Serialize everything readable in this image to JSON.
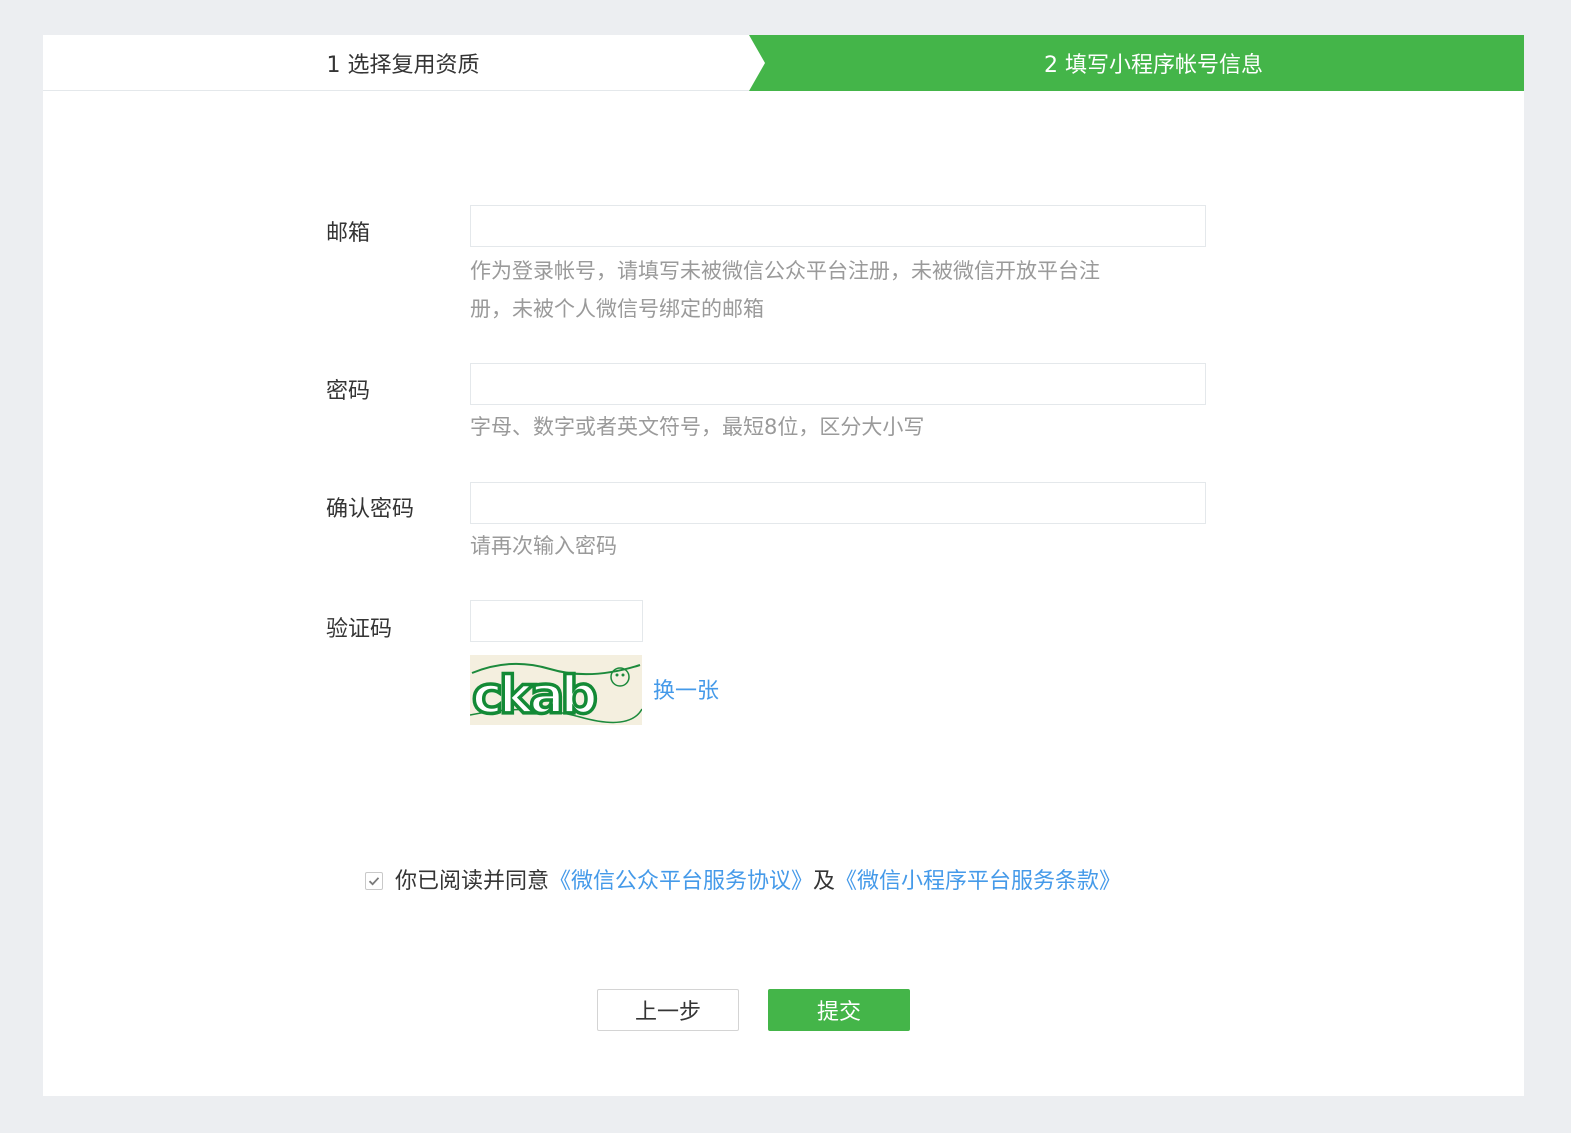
{
  "steps": {
    "step1": "1 选择复用资质",
    "step2": "2 填写小程序帐号信息"
  },
  "form": {
    "email": {
      "label": "邮箱",
      "value": "",
      "tip_line1": "作为登录帐号，请填写未被微信公众平台注册，未被微信开放平台注",
      "tip_line2": "册，未被个人微信号绑定的邮箱"
    },
    "password": {
      "label": "密码",
      "value": "",
      "tip": "字母、数字或者英文符号，最短8位，区分大小写"
    },
    "confirm": {
      "label": "确认密码",
      "value": "",
      "tip": "请再次输入密码"
    },
    "captcha": {
      "label": "验证码",
      "value": "",
      "image_text": "ckab",
      "refresh": "换一张"
    }
  },
  "agreement": {
    "checked": true,
    "prefix": "你已阅读并同意",
    "link1": "《微信公众平台服务协议》",
    "middle": "及",
    "link2": "《微信小程序平台服务条款》"
  },
  "buttons": {
    "prev": "上一步",
    "submit": "提交"
  },
  "colors": {
    "accent": "#44b549",
    "link": "#459ae9"
  }
}
